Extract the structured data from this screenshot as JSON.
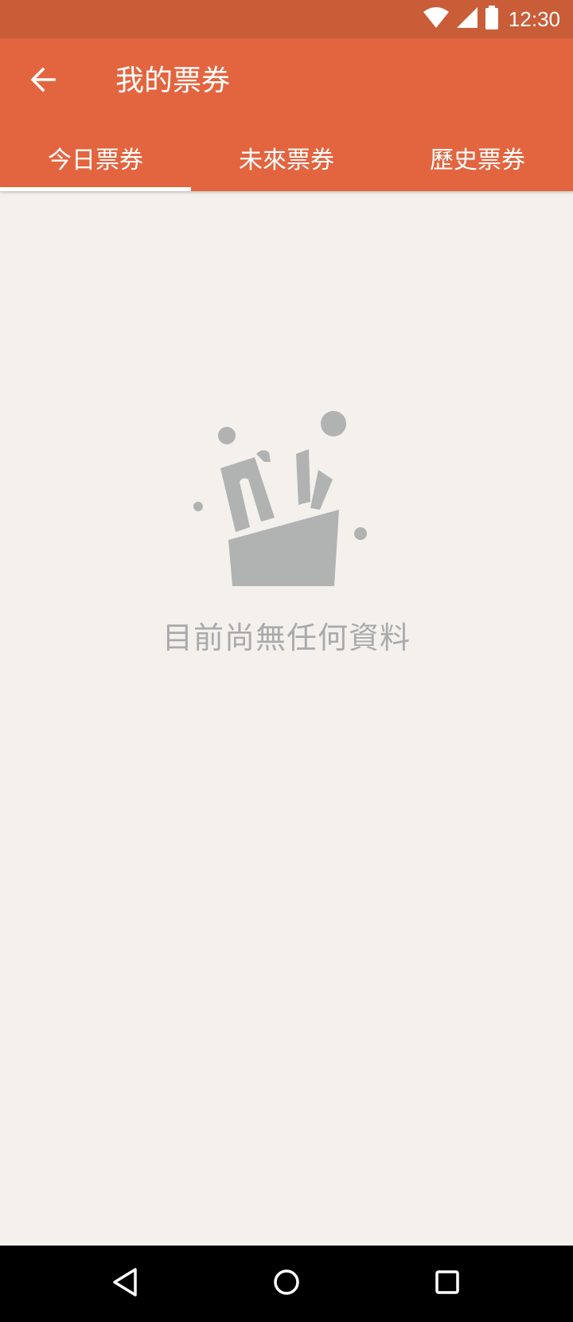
{
  "status_bar": {
    "time": "12:30",
    "icons": [
      "wifi-icon",
      "cell-signal-icon",
      "battery-icon"
    ]
  },
  "app_bar": {
    "back_icon": "arrow-left-icon",
    "title": "我的票券",
    "background": "#e2653f"
  },
  "tabs": [
    {
      "label": "今日票券",
      "selected": true
    },
    {
      "label": "未來票券",
      "selected": false
    },
    {
      "label": "歷史票券",
      "selected": false
    }
  ],
  "empty_state": {
    "illustration": "empty-ticket-box-icon",
    "message": "目前尚無任何資料"
  },
  "nav_bar": {
    "icons": [
      "back-triangle-icon",
      "home-circle-icon",
      "recents-square-icon"
    ]
  },
  "colors": {
    "status_bar": "#c95d38",
    "accent": "#e2653f",
    "page_background": "#f4f1ed",
    "muted_gray": "#a9aaab"
  }
}
